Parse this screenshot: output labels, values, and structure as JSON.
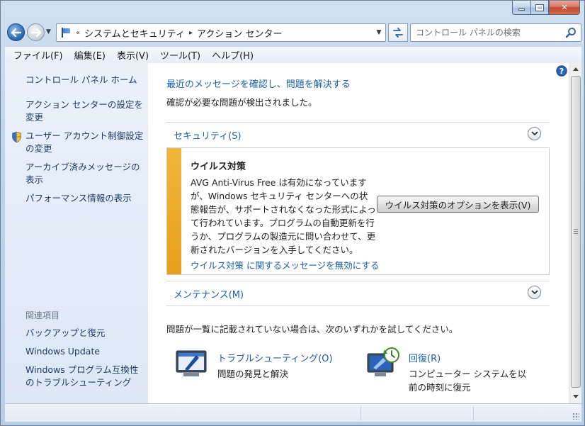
{
  "window": {
    "caption_buttons": {
      "minimize_icon": "minimize-icon",
      "maximize_icon": "maximize-icon",
      "close_icon": "close-icon",
      "close_glyph": "✕"
    }
  },
  "addressbar": {
    "back_icon": "back-arrow-icon",
    "forward_icon": "forward-arrow-icon",
    "overflow": "«",
    "separator": "▸",
    "breadcrumbs": [
      "システムとセキュリティ",
      "アクション センター"
    ],
    "dropdown": "▼",
    "refresh_icon": "refresh-icon",
    "search_placeholder": "コントロール パネルの検索"
  },
  "menubar": {
    "items": [
      "ファイル(F)",
      "編集(E)",
      "表示(V)",
      "ツール(T)",
      "ヘルプ(H)"
    ]
  },
  "sidebar": {
    "links": [
      "コントロール パネル ホーム",
      "アクション センターの設定を変更",
      "ユーザー アカウント制御設定の変更",
      "アーカイブ済みメッセージの表示",
      "パフォーマンス情報の表示"
    ],
    "related_heading": "関連項目",
    "related_links": [
      "バックアップと復元",
      "Windows Update",
      "Windows プログラム互換性のトラブルシューティング"
    ]
  },
  "main": {
    "title": "最近のメッセージを確認し、問題を解決する",
    "subtitle": "確認が必要な問題が検出されました。",
    "security_section": "セキュリティ(S)",
    "virus_alert": {
      "title": "ウイルス対策",
      "body": "AVG Anti-Virus Free は有効になっていますが、Windows セキュリティ センターへの状態報告が、サポートされなくなった形式によって行われています。プログラムの自動更新を行うか、プログラムの製造元に問い合わせて、更新されたバージョンを入手してください。",
      "button": "ウイルス対策のオプションを表示(V)",
      "disable_link": "ウイルス対策 に関するメッセージを無効にする"
    },
    "maintenance_section": "メンテナンス(M)",
    "hint": "問題が一覧に記載されていない場合は、次のいずれかを試してください。",
    "troubleshooting": {
      "title": "トラブルシューティング(O)",
      "desc": "問題の発見と解決"
    },
    "recovery": {
      "title": "回復(R)",
      "desc": "コンピューター システムを以前の時刻に復元"
    }
  },
  "colors": {
    "accent_link": "#1a5fa8",
    "alert_stripe": "#e6a01b",
    "sidebar_bg": "#e4edf8"
  }
}
